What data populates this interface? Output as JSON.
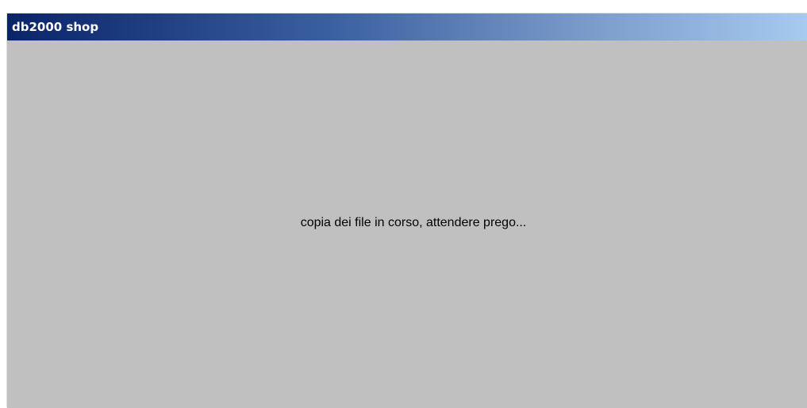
{
  "window": {
    "title": "db2000 shop",
    "message": "copia dei file in corso, attendere prego...",
    "colors": {
      "titlebar_start": "#0a246a",
      "titlebar_end": "#a6caf0",
      "background": "#c0c0c0",
      "title_text": "#ffffff",
      "message_text": "#000000"
    }
  }
}
